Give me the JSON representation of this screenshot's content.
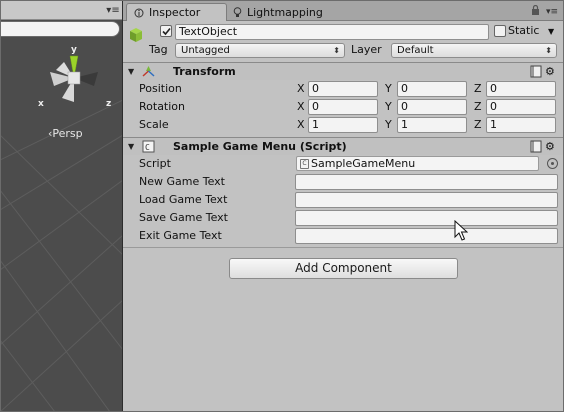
{
  "scene": {
    "menu_icon": "panel-menu-icon",
    "gizmo": {
      "y_label": "y",
      "x_label": "x",
      "z_label": "z"
    },
    "projection_label": "‹Persp"
  },
  "tabs": [
    {
      "label": "Inspector",
      "icon": "inspector-icon",
      "active": true
    },
    {
      "label": "Lightmapping",
      "icon": "lightbulb-icon",
      "active": false
    }
  ],
  "tab_tools": {
    "lock_icon": "lock-icon",
    "menu_icon": "panel-menu-icon"
  },
  "game_object": {
    "active_checked": true,
    "name": "TextObject",
    "static_checked": false,
    "static_label": "Static",
    "tag_label": "Tag",
    "tag_value": "Untagged",
    "layer_label": "Layer",
    "layer_value": "Default"
  },
  "transform": {
    "title": "Transform",
    "rows": [
      {
        "label": "Position",
        "x": "0",
        "y": "0",
        "z": "0"
      },
      {
        "label": "Rotation",
        "x": "0",
        "y": "0",
        "z": "0"
      },
      {
        "label": "Scale",
        "x": "1",
        "y": "1",
        "z": "1"
      }
    ],
    "axes": [
      "X",
      "Y",
      "Z"
    ]
  },
  "script_component": {
    "title": "Sample Game Menu (Script)",
    "script_label": "Script",
    "script_value": "SampleGameMenu",
    "fields": [
      {
        "label": "New Game Text",
        "value": ""
      },
      {
        "label": "Load Game Text",
        "value": ""
      },
      {
        "label": "Save Game Text",
        "value": ""
      },
      {
        "label": "Exit Game Text",
        "value": ""
      }
    ]
  },
  "add_component_label": "Add Component",
  "colors": {
    "panel_bg": "#c2c2c2",
    "scene_bg": "#4c4c4c",
    "gizmo_y": "#9bd22a",
    "gizmo_x": "#cccccc"
  }
}
